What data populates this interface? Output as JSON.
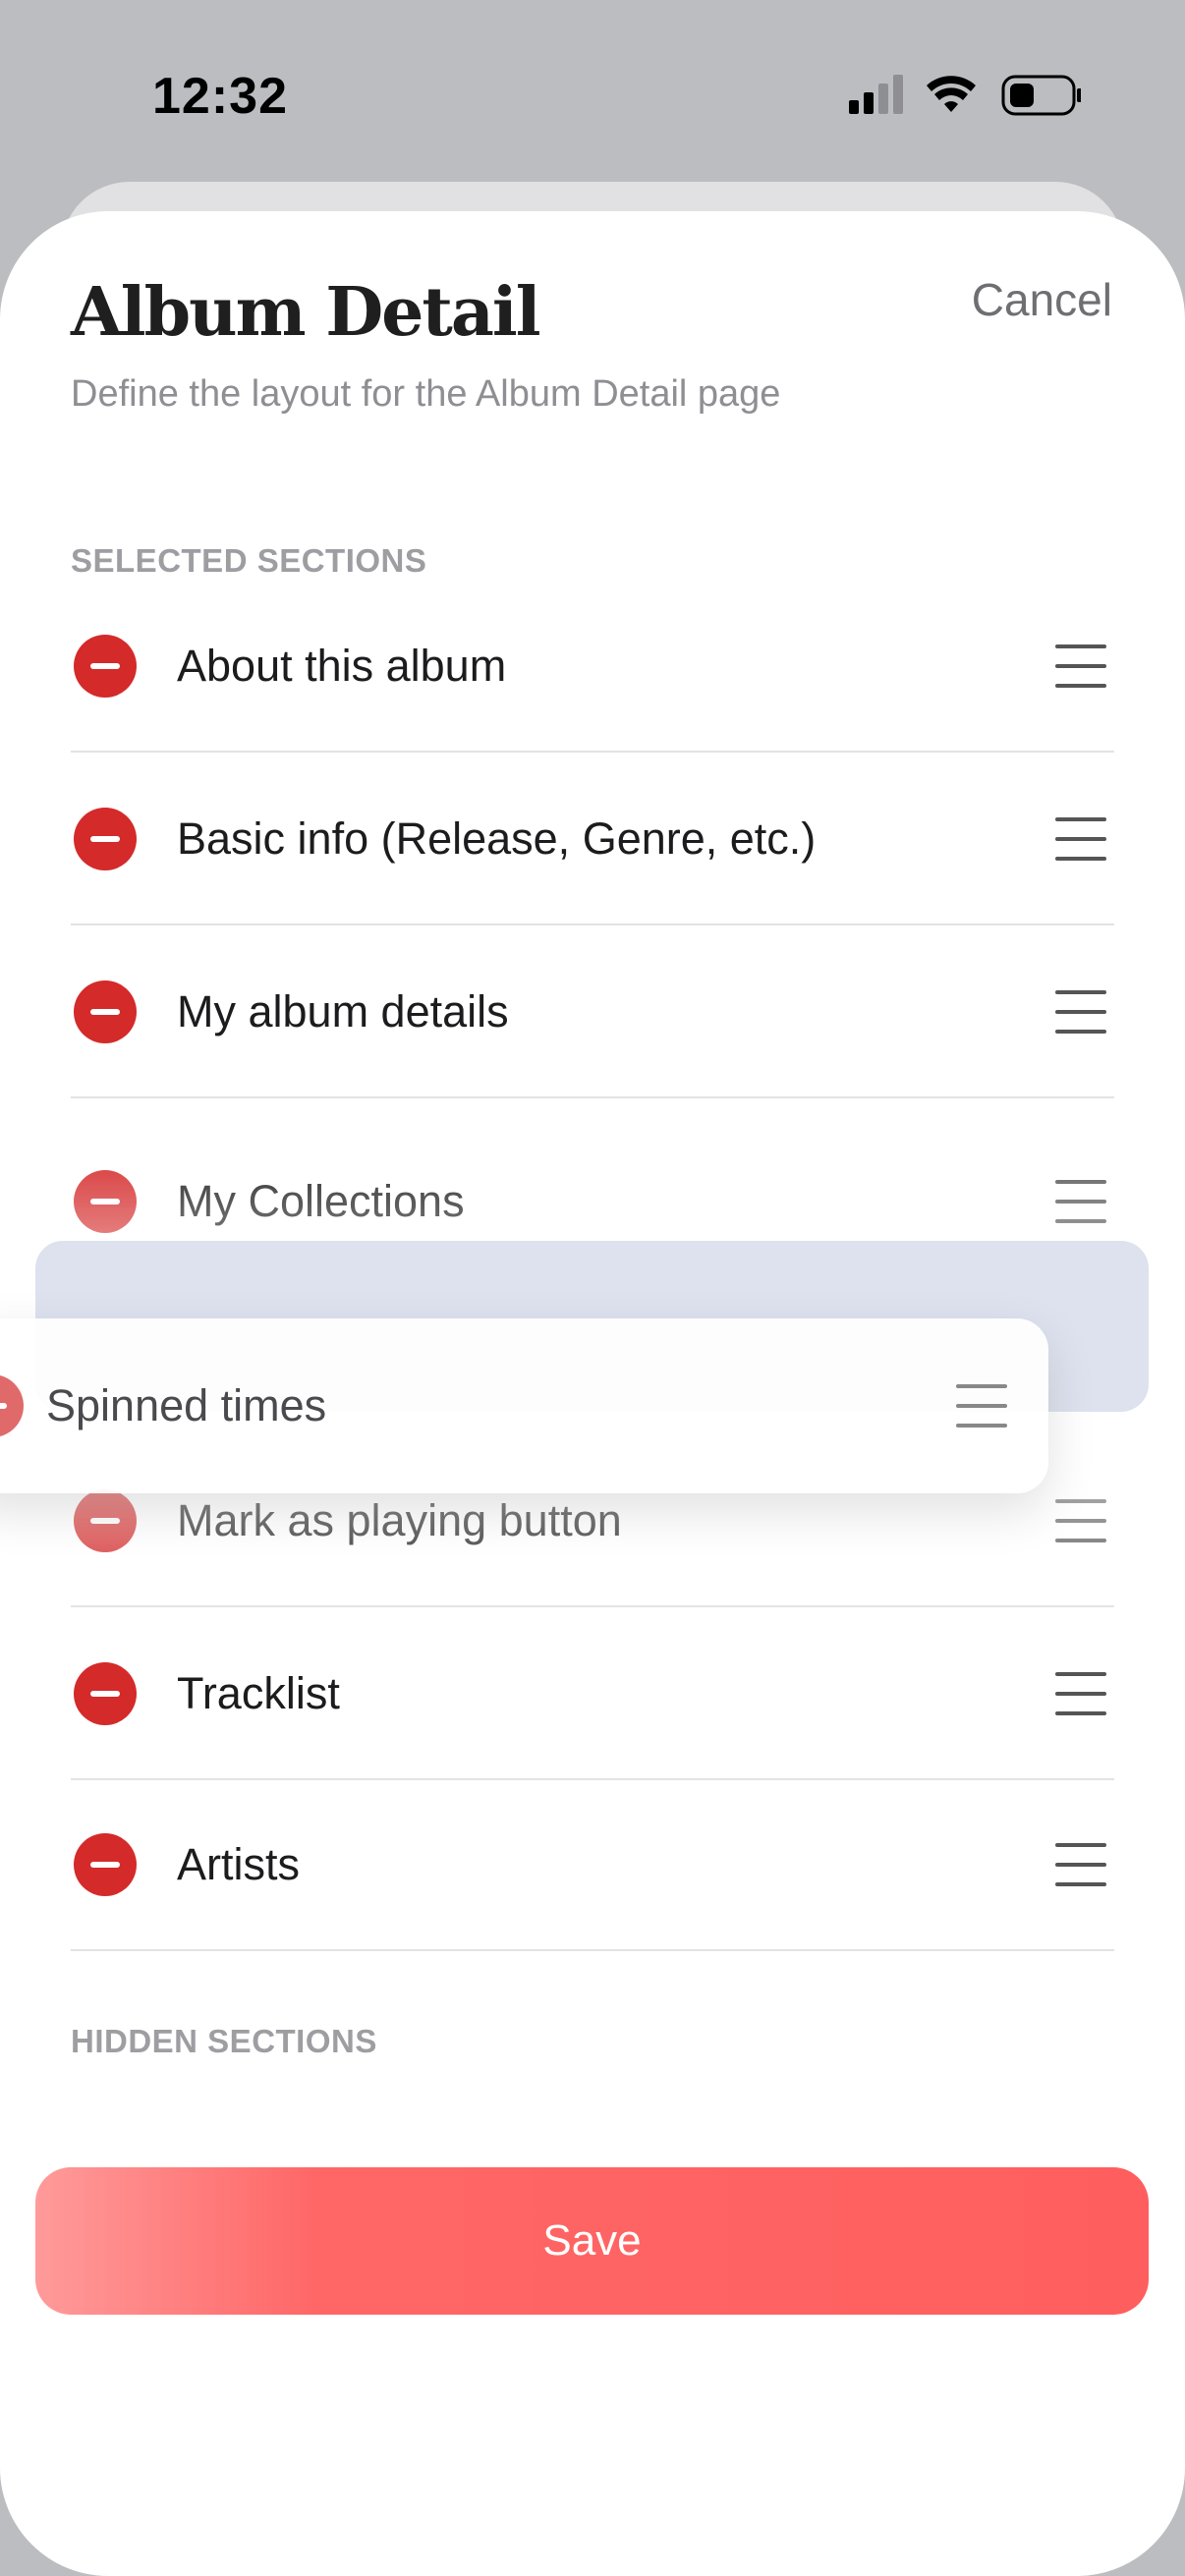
{
  "status_bar": {
    "time": "12:32"
  },
  "sheet": {
    "title": "Album Detail",
    "subtitle": "Define the layout for the Album Detail page",
    "cancel_label": "Cancel"
  },
  "selected_sections": {
    "header": "SELECTED SECTIONS",
    "items": [
      {
        "label": "About this album"
      },
      {
        "label": "Basic info (Release, Genre, etc.)"
      },
      {
        "label": "My album details"
      },
      {
        "label": "My Collections"
      },
      {
        "label": "Mark as playing button"
      },
      {
        "label": "Tracklist"
      },
      {
        "label": "Artists"
      }
    ],
    "dragging_item": {
      "label": "Spinned times"
    }
  },
  "hidden_sections": {
    "header": "HIDDEN SECTIONS"
  },
  "footer": {
    "save_label": "Save"
  },
  "colors": {
    "remove": "#d42a2a",
    "save": "#ff5e5e",
    "drop_placeholder": "#dde2ee"
  },
  "icons": {
    "signal": "cellular-signal-icon",
    "wifi": "wifi-icon",
    "battery": "battery-icon",
    "remove": "remove-circle-icon",
    "reorder": "drag-handle-icon"
  }
}
